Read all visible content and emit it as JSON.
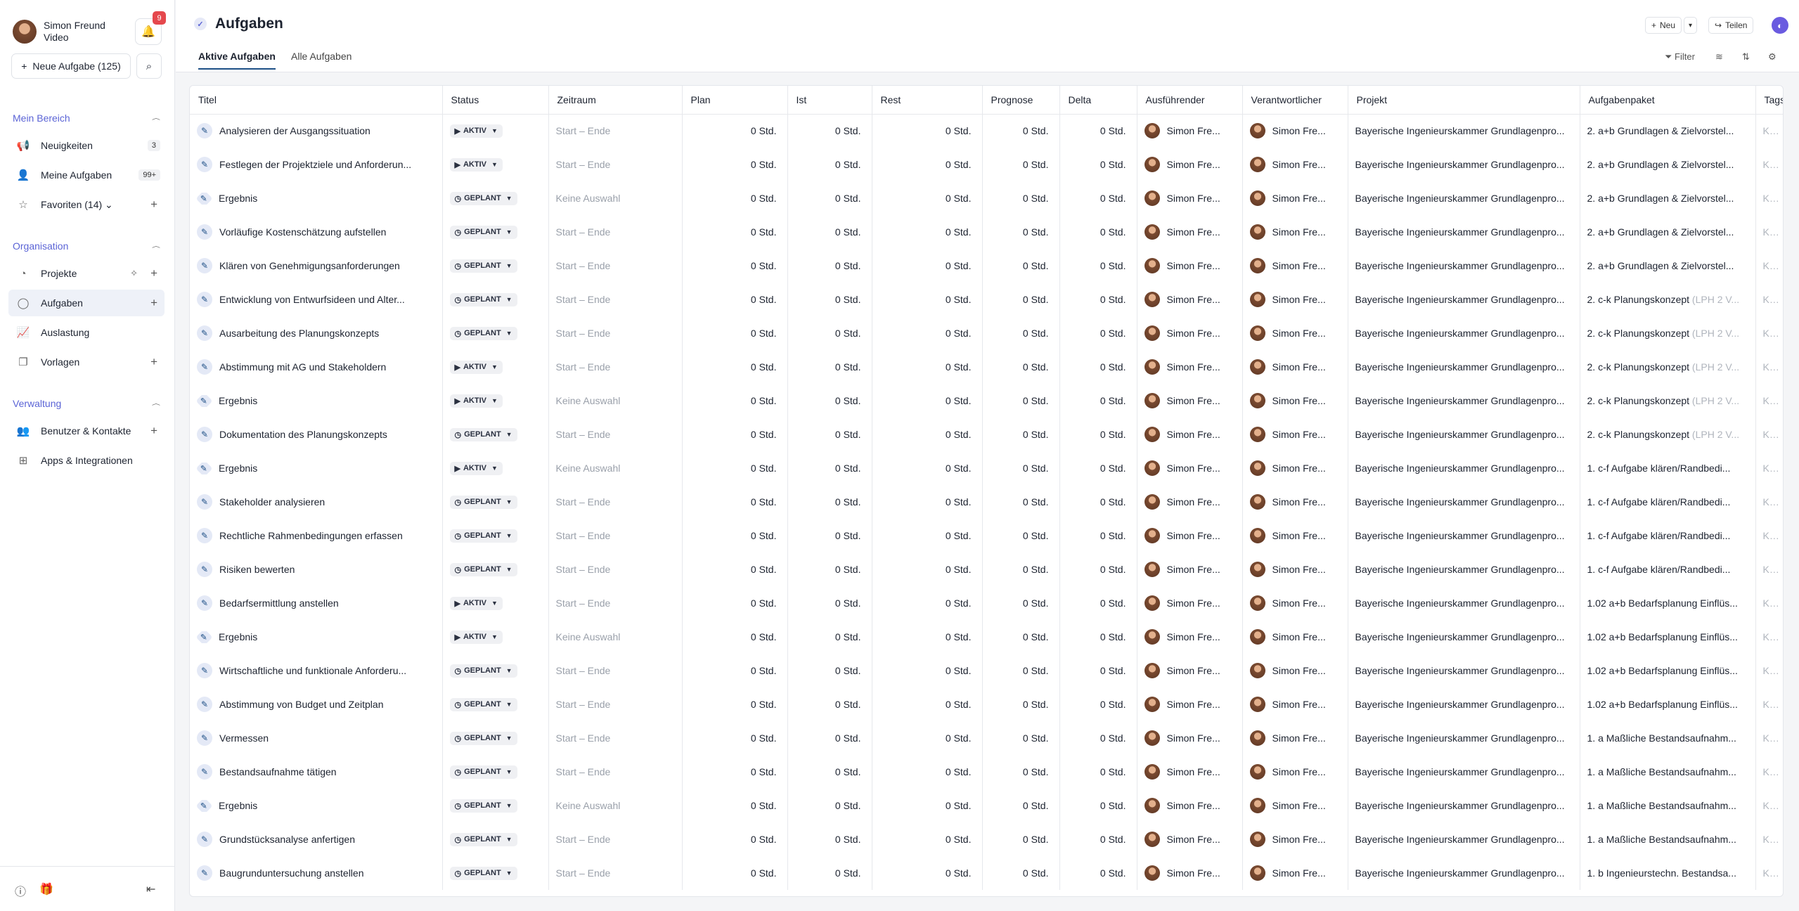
{
  "sidebar": {
    "user_name": "Simon Freund",
    "user_sub": "Video",
    "notif_count": "9",
    "new_task_label": "Neue Aufgabe (125)",
    "section_mine": "Mein Bereich",
    "section_org": "Organisation",
    "section_admin": "Verwaltung",
    "items": [
      {
        "label": "Neuigkeiten",
        "count": "3"
      },
      {
        "label": "Meine Aufgaben",
        "count": "99+"
      },
      {
        "label": "Favoriten (14)"
      },
      {
        "label": "Projekte"
      },
      {
        "label": "Aufgaben"
      },
      {
        "label": "Auslastung"
      },
      {
        "label": "Vorlagen"
      },
      {
        "label": "Benutzer & Kontakte"
      },
      {
        "label": "Apps & Integrationen"
      }
    ]
  },
  "header": {
    "title": "Aufgaben",
    "new_label": "Neu",
    "share_label": "Teilen",
    "tab_active": "Aktive Aufgaben",
    "tab_all": "Alle Aufgaben",
    "filter_label": "Filter"
  },
  "columns": [
    "Titel",
    "Status",
    "Zeitraum",
    "Plan",
    "Ist",
    "Rest",
    "Prognose",
    "Delta",
    "Ausführender",
    "Verantwortlicher",
    "Projekt",
    "Aufgabenpaket",
    "Tags"
  ],
  "defaults": {
    "hours": "0 Std.",
    "person": "Simon Fre...",
    "project": "Bayerische Ingenieurskammer Grundlagenpro...",
    "tags": "Keine A"
  },
  "rows": [
    {
      "title": "Analysieren der Ausgangssituation",
      "type": "task",
      "status": "AKTIV",
      "range": "Start – Ende",
      "pkg": "2. a+b Grundlagen & Zielvorstel...",
      "lph": ""
    },
    {
      "title": "Festlegen der Projektziele und Anforderun...",
      "type": "task",
      "status": "AKTIV",
      "range": "Start – Ende",
      "pkg": "2. a+b Grundlagen & Zielvorstel...",
      "lph": ""
    },
    {
      "title": "Ergebnis",
      "type": "result",
      "status": "GEPLANT",
      "range": "Keine Auswahl",
      "pkg": "2. a+b Grundlagen & Zielvorstel...",
      "lph": ""
    },
    {
      "title": "Vorläufige Kostenschätzung aufstellen",
      "type": "task",
      "status": "GEPLANT",
      "range": "Start – Ende",
      "pkg": "2. a+b Grundlagen & Zielvorstel...",
      "lph": ""
    },
    {
      "title": "Klären von Genehmigungsanforderungen",
      "type": "task",
      "status": "GEPLANT",
      "range": "Start – Ende",
      "pkg": "2. a+b Grundlagen & Zielvorstel...",
      "lph": ""
    },
    {
      "title": "Entwicklung von Entwurfsideen und Alter...",
      "type": "task",
      "status": "GEPLANT",
      "range": "Start – Ende",
      "pkg": "2. c-k Planungskonzept",
      "lph": "(LPH 2 V..."
    },
    {
      "title": "Ausarbeitung des Planungskonzepts",
      "type": "task",
      "status": "GEPLANT",
      "range": "Start – Ende",
      "pkg": "2. c-k Planungskonzept",
      "lph": "(LPH 2 V..."
    },
    {
      "title": "Abstimmung mit AG und Stakeholdern",
      "type": "task",
      "status": "AKTIV",
      "range": "Start – Ende",
      "pkg": "2. c-k Planungskonzept",
      "lph": "(LPH 2 V..."
    },
    {
      "title": "Ergebnis",
      "type": "result",
      "status": "AKTIV",
      "range": "Keine Auswahl",
      "pkg": "2. c-k Planungskonzept",
      "lph": "(LPH 2 V..."
    },
    {
      "title": "Dokumentation des Planungskonzepts",
      "type": "task",
      "status": "GEPLANT",
      "range": "Start – Ende",
      "pkg": "2. c-k Planungskonzept",
      "lph": "(LPH 2 V..."
    },
    {
      "title": "Ergebnis",
      "type": "result",
      "status": "AKTIV",
      "range": "Keine Auswahl",
      "pkg": "1. c-f Aufgabe klären/Randbedi...",
      "lph": ""
    },
    {
      "title": "Stakeholder analysieren",
      "type": "task",
      "status": "GEPLANT",
      "range": "Start – Ende",
      "pkg": "1. c-f Aufgabe klären/Randbedi...",
      "lph": ""
    },
    {
      "title": "Rechtliche Rahmenbedingungen erfassen",
      "type": "task",
      "status": "GEPLANT",
      "range": "Start – Ende",
      "pkg": "1. c-f Aufgabe klären/Randbedi...",
      "lph": ""
    },
    {
      "title": "Risiken bewerten",
      "type": "task",
      "status": "GEPLANT",
      "range": "Start – Ende",
      "pkg": "1. c-f Aufgabe klären/Randbedi...",
      "lph": ""
    },
    {
      "title": "Bedarfsermittlung anstellen",
      "type": "task",
      "status": "AKTIV",
      "range": "Start – Ende",
      "pkg": "1.02 a+b Bedarfsplanung Einflüs...",
      "lph": ""
    },
    {
      "title": "Ergebnis",
      "type": "result",
      "status": "AKTIV",
      "range": "Keine Auswahl",
      "pkg": "1.02 a+b Bedarfsplanung Einflüs...",
      "lph": ""
    },
    {
      "title": "Wirtschaftliche und funktionale Anforderu...",
      "type": "task",
      "status": "GEPLANT",
      "range": "Start – Ende",
      "pkg": "1.02 a+b Bedarfsplanung Einflüs...",
      "lph": ""
    },
    {
      "title": "Abstimmung von Budget und Zeitplan",
      "type": "task",
      "status": "GEPLANT",
      "range": "Start – Ende",
      "pkg": "1.02 a+b Bedarfsplanung Einflüs...",
      "lph": ""
    },
    {
      "title": "Vermessen",
      "type": "task",
      "status": "GEPLANT",
      "range": "Start – Ende",
      "pkg": "1. a Maßliche Bestandsaufnahm...",
      "lph": ""
    },
    {
      "title": "Bestandsaufnahme tätigen",
      "type": "task",
      "status": "GEPLANT",
      "range": "Start – Ende",
      "pkg": "1. a Maßliche Bestandsaufnahm...",
      "lph": ""
    },
    {
      "title": "Ergebnis",
      "type": "result",
      "status": "GEPLANT",
      "range": "Keine Auswahl",
      "pkg": "1. a Maßliche Bestandsaufnahm...",
      "lph": ""
    },
    {
      "title": "Grundstücksanalyse anfertigen",
      "type": "task",
      "status": "GEPLANT",
      "range": "Start – Ende",
      "pkg": "1. a Maßliche Bestandsaufnahm...",
      "lph": ""
    },
    {
      "title": "Baugrunduntersuchung anstellen",
      "type": "task",
      "status": "GEPLANT",
      "range": "Start – Ende",
      "pkg": "1. b Ingenieurstechn. Bestandsa...",
      "lph": ""
    }
  ]
}
